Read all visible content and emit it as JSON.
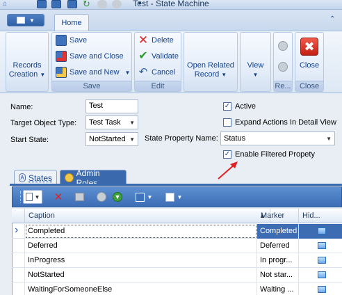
{
  "window": {
    "title": "Test - State Machine"
  },
  "ribbon": {
    "tab_home": "Home",
    "records_creation": "Records Creation",
    "save": "Save",
    "save_and_close": "Save and Close",
    "save_and_new": "Save and New",
    "delete": "Delete",
    "validate": "Validate",
    "cancel": "Cancel",
    "open_related_record": "Open Related Record",
    "view": "View",
    "close": "Close",
    "group_save": "Save",
    "group_edit": "Edit",
    "group_re": "Re...",
    "group_close": "Close"
  },
  "form": {
    "name_label": "Name:",
    "name_value": "Test",
    "target_type_label": "Target Object Type:",
    "target_type_value": "Test Task",
    "start_state_label": "Start State:",
    "start_state_value": "NotStarted",
    "state_property_label": "State Property Name:",
    "state_property_value": "Status",
    "active_label": "Active",
    "expand_actions_label": "Expand Actions In Detail View",
    "enable_filtered_label": "Enable Filtered Propety"
  },
  "detail_tabs": {
    "states": "States",
    "admin_roles": "Admin Roles"
  },
  "grid": {
    "columns": [
      "Caption",
      "Marker",
      "Hid..."
    ],
    "rows": [
      {
        "caption": "Completed",
        "marker": "Completed"
      },
      {
        "caption": "Deferred",
        "marker": "Deferred"
      },
      {
        "caption": "InProgress",
        "marker": "In progr..."
      },
      {
        "caption": "NotStarted",
        "marker": "Not star..."
      },
      {
        "caption": "WaitingForSomeoneElse",
        "marker": "Waiting ..."
      }
    ]
  },
  "colors": {
    "accent": "#3a69ad",
    "annotation_arrow": "#e02020"
  }
}
